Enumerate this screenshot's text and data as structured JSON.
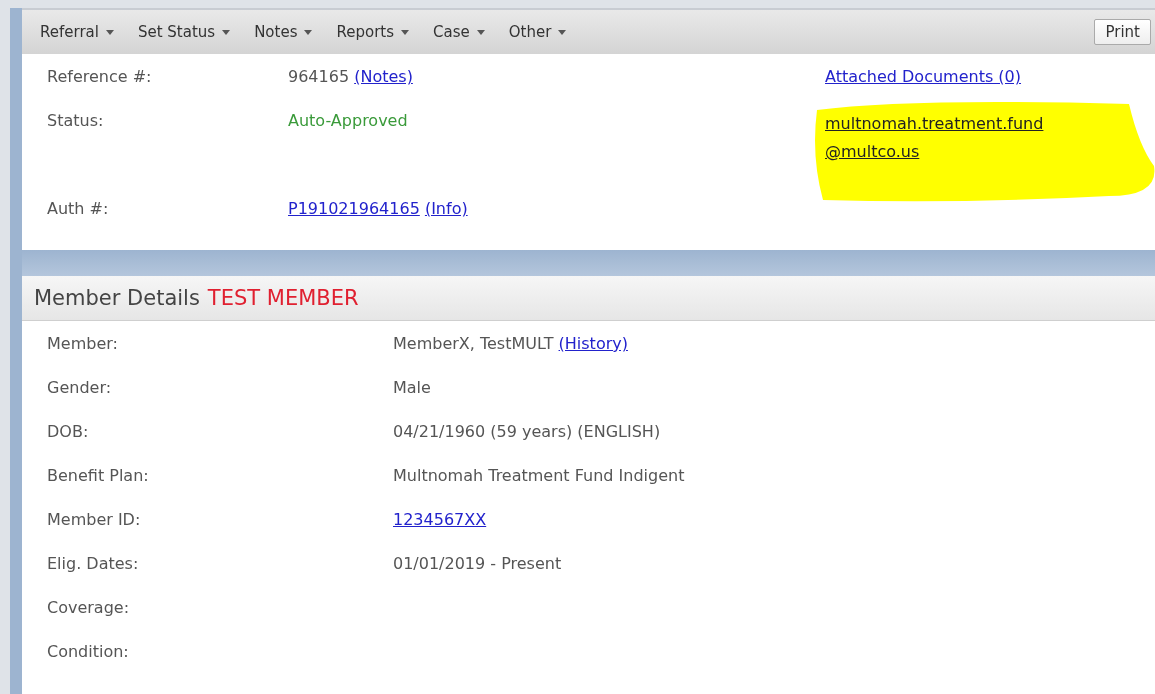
{
  "menu": [
    {
      "label": "Referral"
    },
    {
      "label": "Set Status"
    },
    {
      "label": "Notes"
    },
    {
      "label": "Reports"
    },
    {
      "label": "Case"
    },
    {
      "label": "Other"
    }
  ],
  "print_button": "Print",
  "referral": {
    "reference": {
      "label": "Reference #:",
      "value": "964165",
      "link": "(Notes)"
    },
    "status": {
      "label": "Status:",
      "value": "Auto-Approved"
    },
    "auth": {
      "label": "Auth #:",
      "link": "P191021964165",
      "info_link": "(Info)"
    },
    "attached_documents": "Attached Documents (0)",
    "email": {
      "lines": [
        "multnomah.treatment.fund",
        "@multco.us"
      ],
      "highlighted": true
    }
  },
  "member_details": {
    "title": "Member Details",
    "flag": "TEST MEMBER",
    "fields": [
      {
        "label": "Member:",
        "value": "MemberX, TestMULT",
        "link": "(History)"
      },
      {
        "label": "Gender:",
        "value": "Male"
      },
      {
        "label": "DOB:",
        "value": "04/21/1960 (59 years) (ENGLISH)"
      },
      {
        "label": "Benefit Plan:",
        "value": "Multnomah Treatment Fund Indigent"
      },
      {
        "label": "Member ID:",
        "link": "1234567XX"
      },
      {
        "label": "Elig. Dates:",
        "value": "01/01/2019 - Present"
      },
      {
        "label": "Coverage:"
      },
      {
        "label": "Condition:"
      }
    ]
  }
}
